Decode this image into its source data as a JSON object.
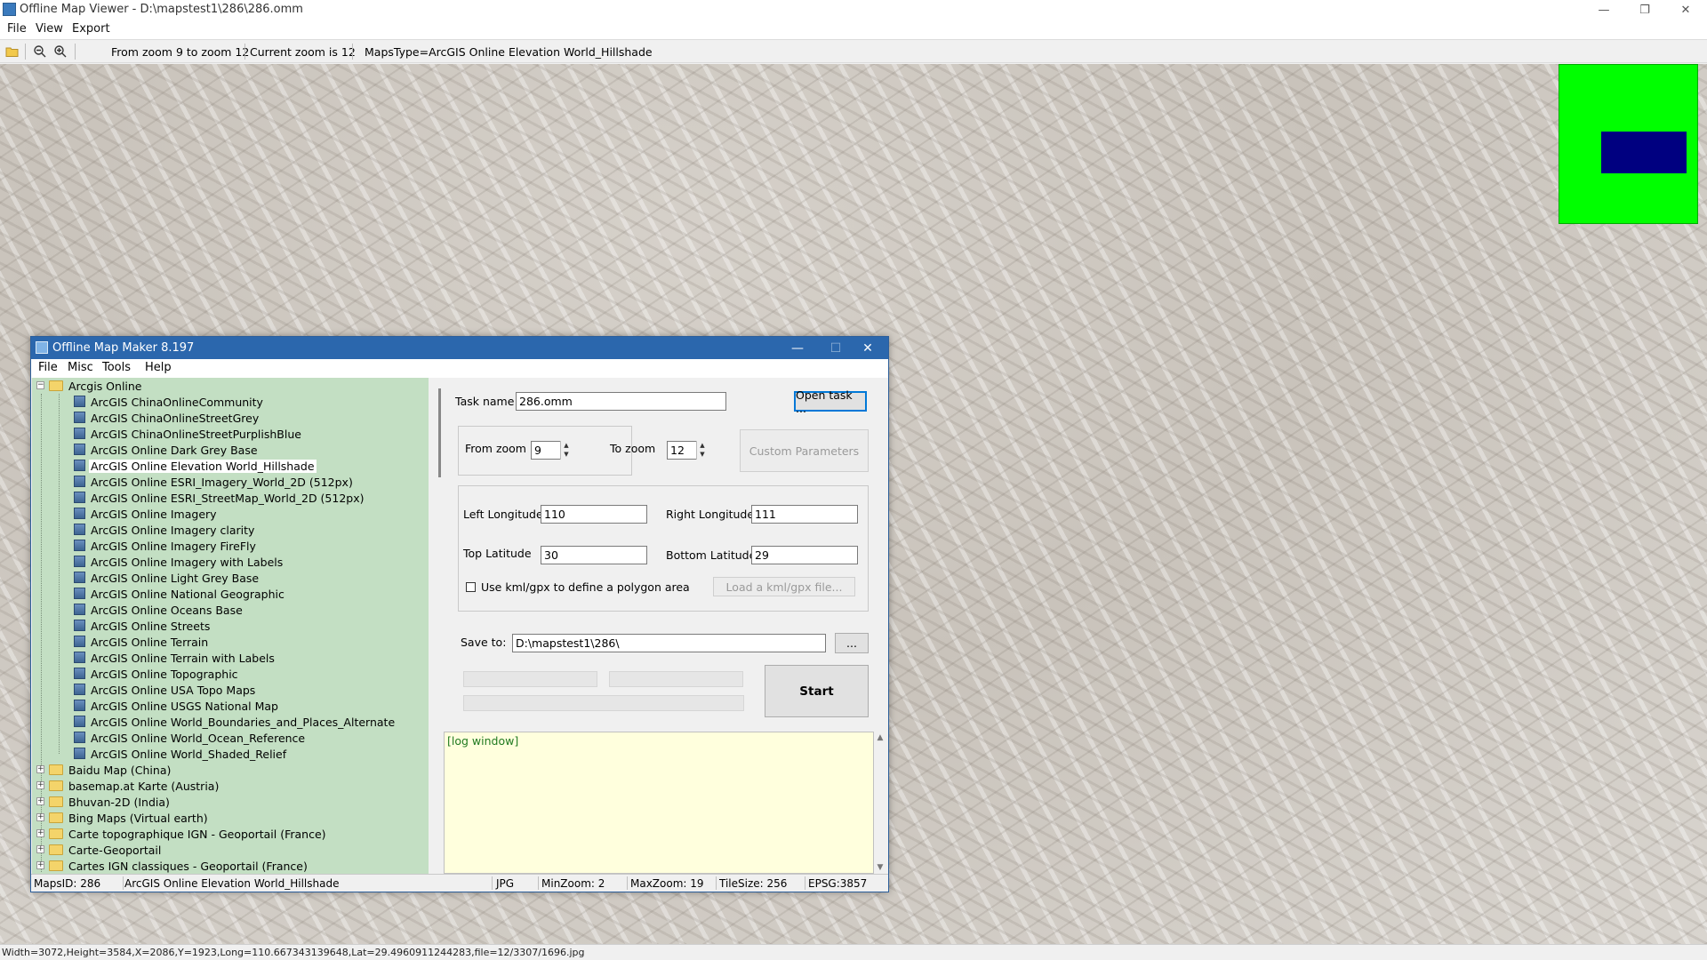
{
  "main_window": {
    "title": "Offline Map Viewer - D:\\mapstest1\\286\\286.omm",
    "menu": [
      "File",
      "View",
      "Export"
    ],
    "toolbar": {
      "zoom_range": "From zoom 9 to zoom 12",
      "current_zoom": "Current zoom is 12",
      "maps_type": "MapsType=ArcGIS Online Elevation World_Hillshade"
    },
    "status_line": "Width=3072,Height=3584,X=2086,Y=1923,Long=110.667343139648,Lat=29.4960911244283,file=12/3307/1696.jpg",
    "overview_colors": {
      "background": "#00ff00",
      "viewport": "#000080"
    }
  },
  "dialog": {
    "title": "Offline Map Maker 8.197",
    "menu": [
      "File",
      "Misc",
      "Tools",
      "Help"
    ],
    "tree": {
      "root": "Arcgis Online",
      "selected": "ArcGIS Online Elevation World_Hillshade",
      "children": [
        "ArcGIS ChinaOnlineCommunity",
        "ArcGIS ChinaOnlineStreetGrey",
        "ArcGIS ChinaOnlineStreetPurplishBlue",
        "ArcGIS Online Dark Grey Base",
        "ArcGIS Online Elevation World_Hillshade",
        "ArcGIS Online ESRI_Imagery_World_2D (512px)",
        "ArcGIS Online ESRI_StreetMap_World_2D (512px)",
        "ArcGIS Online Imagery",
        "ArcGIS Online Imagery clarity",
        "ArcGIS Online Imagery FireFly",
        "ArcGIS Online Imagery with Labels",
        "ArcGIS Online Light Grey Base",
        "ArcGIS Online National Geographic",
        "ArcGIS Online Oceans Base",
        "ArcGIS Online Streets",
        "ArcGIS Online Terrain",
        "ArcGIS Online Terrain with Labels",
        "ArcGIS Online Topographic",
        "ArcGIS Online USA Topo Maps",
        "ArcGIS Online USGS National Map",
        "ArcGIS Online World_Boundaries_and_Places_Alternate",
        "ArcGIS Online World_Ocean_Reference",
        "ArcGIS Online World_Shaded_Relief"
      ],
      "folders": [
        "Baidu Map (China)",
        "basemap.at Karte (Austria)",
        "Bhuvan-2D (India)",
        "Bing Maps (Virtual earth)",
        "Carte topographique IGN - Geoportail (France)",
        "Carte-Geoportail",
        "Cartes IGN classiques - Geoportail (France)"
      ]
    },
    "form": {
      "task_name_label": "Task name",
      "task_name_value": "286.omm",
      "open_task": "Open task ...",
      "from_zoom_label": "From zoom",
      "from_zoom_value": "9",
      "to_zoom_label": "To zoom",
      "to_zoom_value": "12",
      "custom_params": "Custom Parameters",
      "left_lon_label": "Left Longitude",
      "left_lon_value": "110",
      "right_lon_label": "Right Longitude",
      "right_lon_value": "111",
      "top_lat_label": "Top Latitude",
      "top_lat_value": "30",
      "bottom_lat_label": "Bottom Latitude",
      "bottom_lat_value": "29",
      "kml_label": "Use kml/gpx to define a polygon area",
      "kml_button": "Load a kml/gpx file...",
      "save_to_label": "Save to:",
      "save_to_value": "D:\\mapstest1\\286\\",
      "browse": "...",
      "start": "Start",
      "log": "[log window]"
    },
    "status": {
      "maps_id": "MapsID: 286",
      "map_name": "ArcGIS Online Elevation World_Hillshade",
      "format": "JPG",
      "min_zoom": "MinZoom: 2",
      "max_zoom": "MaxZoom: 19",
      "tile_size": "TileSize: 256",
      "epsg": "EPSG:3857"
    }
  }
}
